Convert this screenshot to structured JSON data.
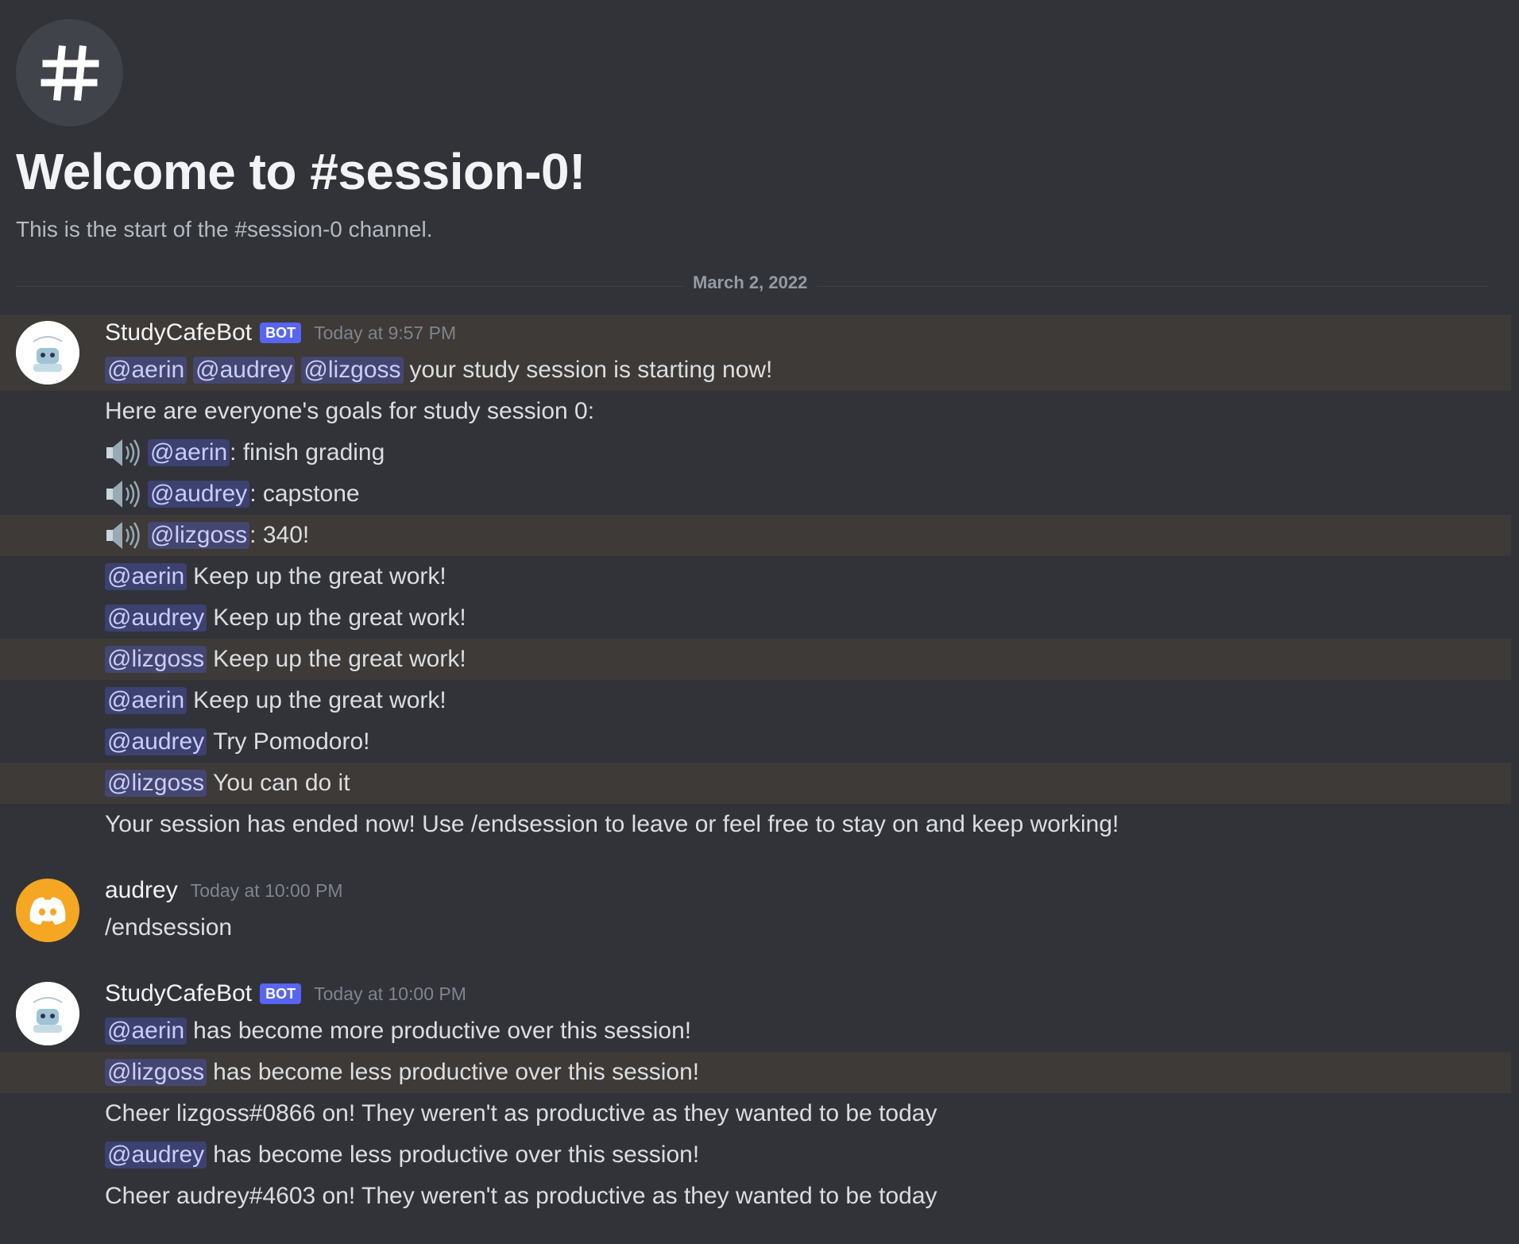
{
  "welcome": {
    "title": "Welcome to #session-0!",
    "subtitle": "This is the start of the #session-0 channel."
  },
  "date_divider": "March 2, 2022",
  "messages": [
    {
      "author": "StudyCafeBot",
      "badge": "BOT",
      "timestamp": "Today at 9:57 PM",
      "lines": {
        "l1": {
          "mentions": [
            "@aerin",
            "@audrey",
            "@lizgoss"
          ],
          "text": "your study session is starting now!"
        },
        "l2": {
          "text": "Here are everyone's goals for study session 0:"
        },
        "l3": {
          "mention": "@aerin",
          "text": ": finish grading"
        },
        "l4": {
          "mention": "@audrey",
          "text": ": capstone"
        },
        "l5": {
          "mention": "@lizgoss",
          "text": ": 340!"
        },
        "l6": {
          "mention": "@aerin",
          "text": "Keep up the great work!"
        },
        "l7": {
          "mention": "@audrey",
          "text": "Keep up the great work!"
        },
        "l8": {
          "mention": "@lizgoss",
          "text": "Keep up the great work!"
        },
        "l9": {
          "mention": "@aerin",
          "text": "Keep up the great work!"
        },
        "l10": {
          "mention": "@audrey",
          "text": "Try Pomodoro!"
        },
        "l11": {
          "mention": "@lizgoss",
          "text": "You can do it"
        },
        "l12": {
          "text": "Your session has ended now! Use /endsession to leave or feel free to stay on and keep working!"
        }
      }
    },
    {
      "author": "audrey",
      "timestamp": "Today at 10:00 PM",
      "lines": {
        "l1": {
          "text": "/endsession"
        }
      }
    },
    {
      "author": "StudyCafeBot",
      "badge": "BOT",
      "timestamp": "Today at 10:00 PM",
      "lines": {
        "l1": {
          "mention": "@aerin",
          "text": "has become more productive over this session!"
        },
        "l2": {
          "mention": "@lizgoss",
          "text": "has become less productive over this session!"
        },
        "l3": {
          "text": "Cheer lizgoss#0866 on! They weren't as productive as they wanted to be today"
        },
        "l4": {
          "mention": "@audrey",
          "text": "has become less productive over this session!"
        },
        "l5": {
          "text": "Cheer audrey#4603 on! They weren't as productive as they wanted to be today"
        }
      }
    }
  ],
  "colors": {
    "background": "#313338",
    "highlight": "#3d3a37",
    "mention_bg": "#3c4270",
    "mention_text": "#c9cdfb",
    "bot_badge": "#5865f2",
    "user_avatar": "#f5a623"
  },
  "icons": [
    "hash-icon",
    "speaker-icon",
    "bot-avatar-icon",
    "discord-logo-icon"
  ]
}
